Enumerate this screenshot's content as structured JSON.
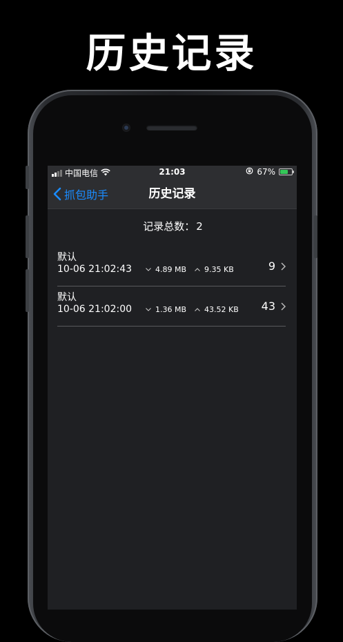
{
  "headline": "历史记录",
  "status_bar": {
    "carrier": "中国电信",
    "time": "21:03",
    "battery_percent": "67%",
    "battery_level": 0.67
  },
  "nav": {
    "back_label": "抓包助手",
    "title": "历史记录"
  },
  "summary": {
    "label": "记录总数：",
    "count": "2"
  },
  "records": [
    {
      "name": "默认",
      "datetime": "10-06 21:02:43",
      "download": "4.89 MB",
      "upload": "9.35 KB",
      "count": "9"
    },
    {
      "name": "默认",
      "datetime": "10-06 21:02:00",
      "download": "1.36 MB",
      "upload": "43.52 KB",
      "count": "43"
    }
  ],
  "colors": {
    "accent": "#1a8cff",
    "screen_bg": "#1f2023",
    "bar_bg": "#2d2e31",
    "battery_fill": "#35c759"
  }
}
